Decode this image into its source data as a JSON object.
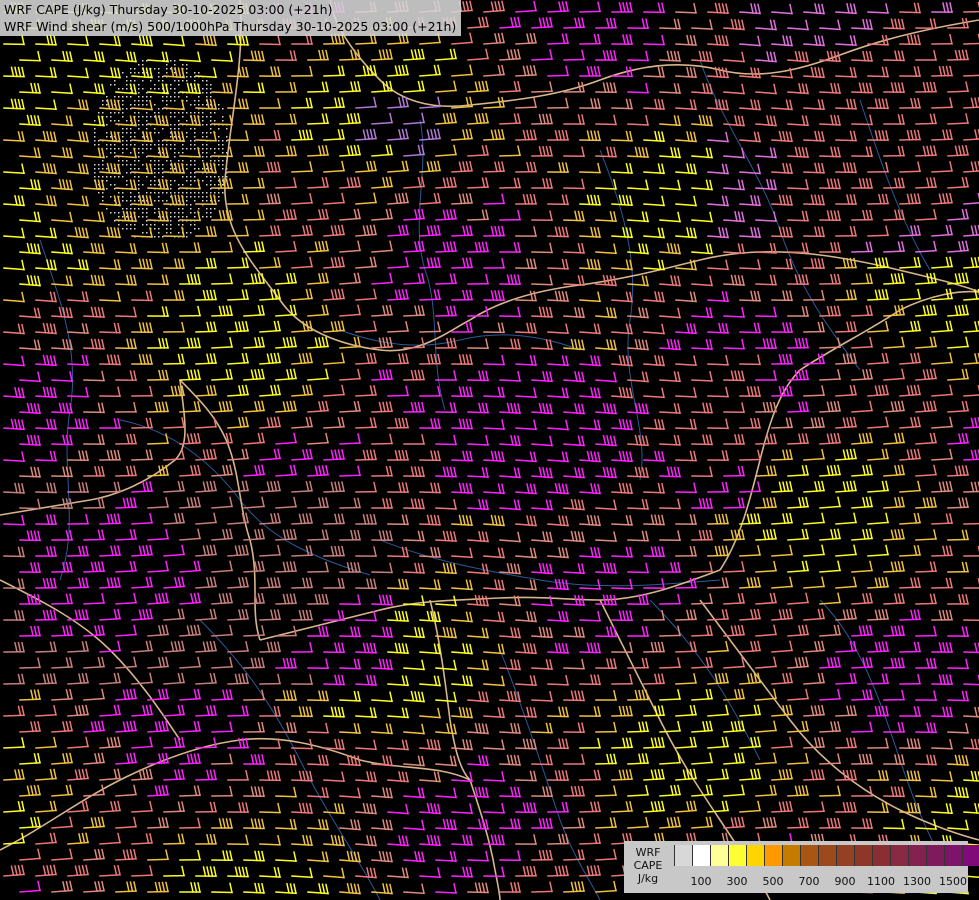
{
  "titles": {
    "line1": "WRF CAPE (J/kg) Thursday 30-10-2025 03:00 (+21h)",
    "line2": "WRF Wind shear (m/s) 500/1000hPa Thursday 30-10-2025 03:00 (+21h)"
  },
  "legend": {
    "label_lines": [
      "WRF",
      "CAPE",
      "J/kg"
    ],
    "tick_labels": [
      "100",
      "300",
      "500",
      "700",
      "900",
      "1100",
      "1300",
      "1500"
    ],
    "colors": [
      "#d8d8d8",
      "#ffffff",
      "#ffff99",
      "#ffff33",
      "#ffd500",
      "#ff9900",
      "#c47b00",
      "#a95612",
      "#9a4a1c",
      "#944025",
      "#8e3628",
      "#8a2e33",
      "#882a42",
      "#84214f",
      "#7f1a5c",
      "#7d146a",
      "#800a7a"
    ]
  },
  "map_colors": {
    "background": "#000000",
    "border": "#d7b58c",
    "river": "#2a5a9a",
    "shear_classes": [
      "#ffff22",
      "#f0c040",
      "#e08a7a",
      "#ee7777",
      "#c87f7a",
      "#ff22ff",
      "#b07ad8",
      "#e06fe0"
    ]
  }
}
